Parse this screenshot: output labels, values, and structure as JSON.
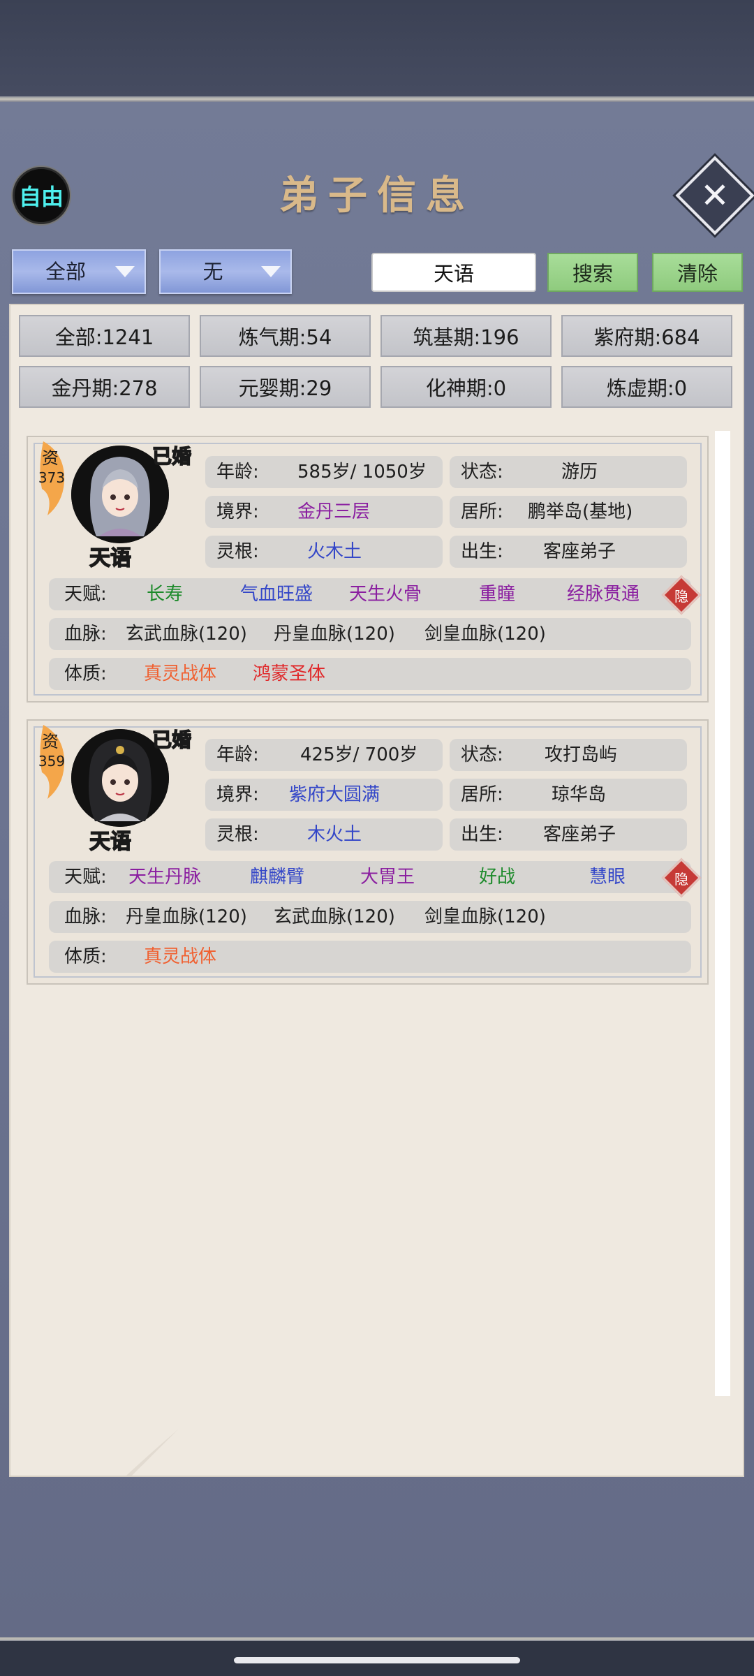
{
  "header": {
    "mode_badge": "自由",
    "title": "弟子信息",
    "close_icon": "close-x-icon"
  },
  "filters": {
    "dropdown1": "全部",
    "dropdown2": "无",
    "search_value": "天语",
    "search_button": "搜索",
    "clear_button": "清除"
  },
  "stats": [
    "全部:1241",
    "炼气期:54",
    "筑基期:196",
    "紫府期:684",
    "金丹期:278",
    "元婴期:29",
    "化神期:0",
    "炼虚期:0"
  ],
  "colors": {
    "purple": "#8a1ea0",
    "blue": "#3346c8",
    "green": "#1c8a2a",
    "orange": "#f06030",
    "red": "#e0282a",
    "gold_text": "#ffe94a"
  },
  "disciples": [
    {
      "aptitude_label": "资",
      "aptitude_value": "373",
      "married": "已婚",
      "name": "天语",
      "age_label": "年龄:",
      "age_value": "585岁/ 1050岁",
      "status_label": "状态:",
      "status_value": "游历",
      "realm_label": "境界:",
      "realm_value": "金丹三层",
      "residence_label": "居所:",
      "residence_value": "鹏举岛(基地)",
      "root_label": "灵根:",
      "root_value": "火木土",
      "birth_label": "出生:",
      "birth_value": "客座弟子",
      "talent_label": "天赋:",
      "talents": [
        "长寿",
        "气血旺盛",
        "天生火骨",
        "重瞳",
        "经脉贯通"
      ],
      "hide_label": "隐",
      "bloodline_label": "血脉:",
      "bloodlines": [
        "玄武血脉(120)",
        "丹皇血脉(120)",
        "剑皇血脉(120)"
      ],
      "physique_label": "体质:",
      "physiques": [
        "真灵战体",
        "鸿蒙圣体"
      ]
    },
    {
      "aptitude_label": "资",
      "aptitude_value": "359",
      "married": "已婚",
      "name": "天语",
      "age_label": "年龄:",
      "age_value": "425岁/ 700岁",
      "status_label": "状态:",
      "status_value": "攻打岛屿",
      "realm_label": "境界:",
      "realm_value": "紫府大圆满",
      "residence_label": "居所:",
      "residence_value": "琼华岛",
      "root_label": "灵根:",
      "root_value": "木火土",
      "birth_label": "出生:",
      "birth_value": "客座弟子",
      "talent_label": "天赋:",
      "talents": [
        "天生丹脉",
        "麒麟臂",
        "大胃王",
        "好战",
        "慧眼"
      ],
      "hide_label": "隐",
      "bloodline_label": "血脉:",
      "bloodlines": [
        "丹皇血脉(120)",
        "玄武血脉(120)",
        "剑皇血脉(120)"
      ],
      "physique_label": "体质:",
      "physiques": [
        "真灵战体"
      ]
    }
  ]
}
